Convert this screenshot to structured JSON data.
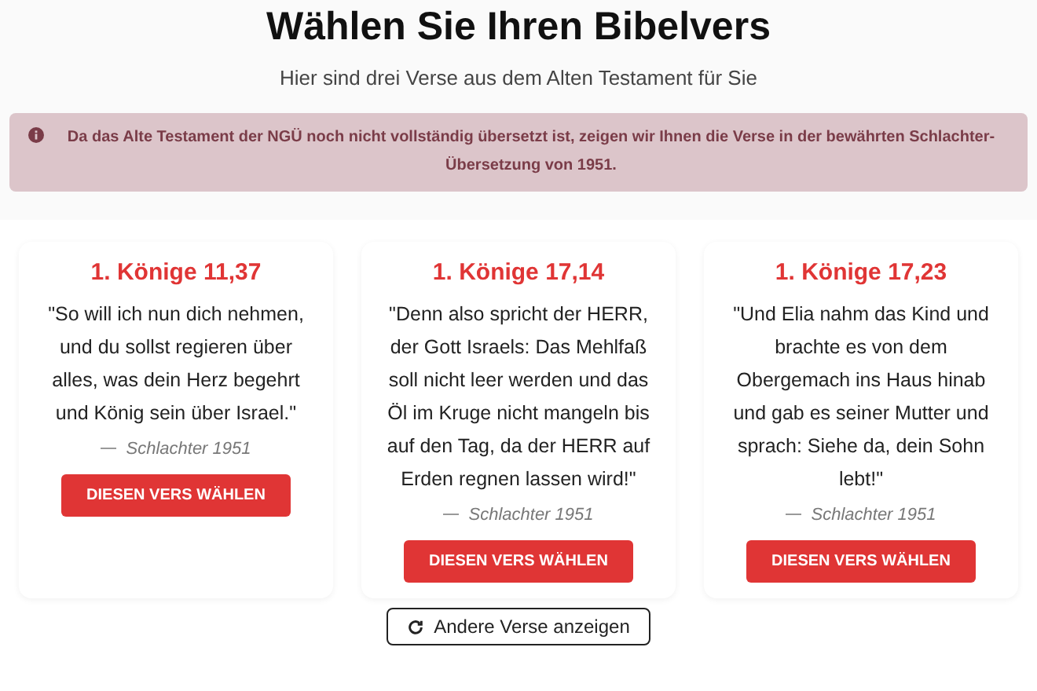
{
  "title": "Wählen Sie Ihren Bibelvers",
  "subtitle": "Hier sind drei Verse aus dem Alten Testament für Sie",
  "notice": "Da das Alte Testament der NGÜ noch nicht vollständig übersetzt ist, zeigen wir Ihnen die Verse in der bewährten Schlachter-Übersetzung von 1951.",
  "verses": [
    {
      "reference": "1. Könige 11,37",
      "text": "\"So will ich nun dich nehmen, und du sollst regieren über alles, was dein Herz begehrt und König sein über Israel.\"",
      "source": "Schlachter 1951",
      "button": "DIESEN VERS WÄHLEN"
    },
    {
      "reference": "1. Könige 17,14",
      "text": "\"Denn also spricht der HERR, der Gott Israels: Das Mehlfaß soll nicht leer werden und das Öl im Kruge nicht mangeln bis auf den Tag, da der HERR auf Erden regnen lassen wird!\"",
      "source": "Schlachter 1951",
      "button": "DIESEN VERS WÄHLEN"
    },
    {
      "reference": "1. Könige 17,23",
      "text": "\"Und Elia nahm das Kind und brachte es von dem Obergemach ins Haus hinab und gab es seiner Mutter und sprach: Siehe da, dein Sohn lebt!\"",
      "source": "Schlachter 1951",
      "button": "DIESEN VERS WÄHLEN"
    }
  ],
  "more_button": "Andere Verse anzeigen"
}
